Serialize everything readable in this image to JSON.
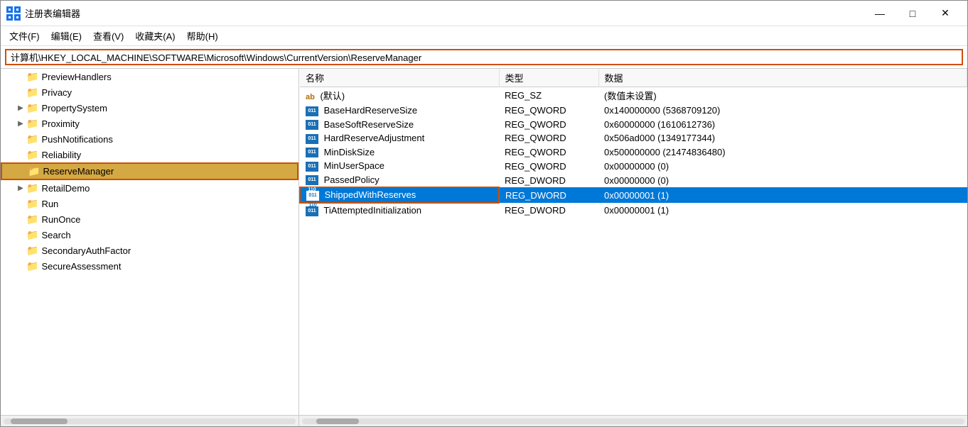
{
  "window": {
    "title": "注册表编辑器",
    "minimize": "—",
    "maximize": "□",
    "close": "✕"
  },
  "menu": {
    "items": [
      "文件(F)",
      "编辑(E)",
      "查看(V)",
      "收藏夹(A)",
      "帮助(H)"
    ]
  },
  "address": {
    "value": "计算机\\HKEY_LOCAL_MACHINE\\SOFTWARE\\Microsoft\\Windows\\CurrentVersion\\ReserveManager"
  },
  "tree": {
    "items": [
      {
        "label": "PreviewHandlers",
        "indent": 1,
        "hasArrow": false,
        "selected": false
      },
      {
        "label": "Privacy",
        "indent": 1,
        "hasArrow": false,
        "selected": false
      },
      {
        "label": "PropertySystem",
        "indent": 1,
        "hasArrow": true,
        "selected": false
      },
      {
        "label": "Proximity",
        "indent": 1,
        "hasArrow": true,
        "selected": false
      },
      {
        "label": "PushNotifications",
        "indent": 1,
        "hasArrow": false,
        "selected": false
      },
      {
        "label": "Reliability",
        "indent": 1,
        "hasArrow": false,
        "selected": false
      },
      {
        "label": "ReserveManager",
        "indent": 1,
        "hasArrow": false,
        "selected": true
      },
      {
        "label": "RetailDemo",
        "indent": 1,
        "hasArrow": true,
        "selected": false
      },
      {
        "label": "Run",
        "indent": 1,
        "hasArrow": false,
        "selected": false
      },
      {
        "label": "RunOnce",
        "indent": 1,
        "hasArrow": false,
        "selected": false
      },
      {
        "label": "Search",
        "indent": 1,
        "hasArrow": false,
        "selected": false
      },
      {
        "label": "SecondaryAuthFactor",
        "indent": 1,
        "hasArrow": false,
        "selected": false
      },
      {
        "label": "SecureAssessment",
        "indent": 1,
        "hasArrow": false,
        "selected": false
      }
    ]
  },
  "table": {
    "columns": [
      "名称",
      "类型",
      "数据"
    ],
    "rows": [
      {
        "name": "(默认)",
        "nameIcon": "ab",
        "type": "REG_SZ",
        "data": "(数值未设置)",
        "selected": false
      },
      {
        "name": "BaseHardReserveSize",
        "nameIcon": "bits",
        "type": "REG_QWORD",
        "data": "0x140000000 (5368709120)",
        "selected": false
      },
      {
        "name": "BaseSoftReserveSize",
        "nameIcon": "bits",
        "type": "REG_QWORD",
        "data": "0x60000000 (1610612736)",
        "selected": false
      },
      {
        "name": "HardReserveAdjustment",
        "nameIcon": "bits",
        "type": "REG_QWORD",
        "data": "0x506ad000 (1349177344)",
        "selected": false
      },
      {
        "name": "MinDiskSize",
        "nameIcon": "bits",
        "type": "REG_QWORD",
        "data": "0x500000000 (21474836480)",
        "selected": false
      },
      {
        "name": "MinUserSpace",
        "nameIcon": "bits",
        "type": "REG_QWORD",
        "data": "0x00000000 (0)",
        "selected": false
      },
      {
        "name": "PassedPolicy",
        "nameIcon": "bits",
        "type": "REG_DWORD",
        "data": "0x00000000 (0)",
        "selected": false
      },
      {
        "name": "ShippedWithReserves",
        "nameIcon": "bits",
        "type": "REG_DWORD",
        "data": "0x00000001 (1)",
        "selected": true
      },
      {
        "name": "TiAttemptedInitialization",
        "nameIcon": "bits",
        "type": "REG_DWORD",
        "data": "0x00000001 (1)",
        "selected": false
      }
    ]
  }
}
